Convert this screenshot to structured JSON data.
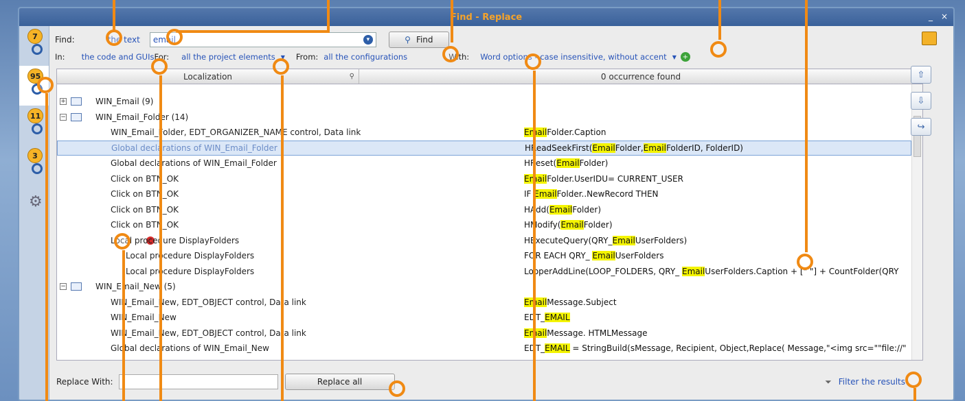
{
  "window": {
    "title": "Find - Replace",
    "minimize": "_",
    "close": "×"
  },
  "sidebar": {
    "tabs": [
      {
        "badge": "7",
        "icon": "search-icon"
      },
      {
        "badge": "95",
        "icon": "search-icon"
      },
      {
        "badge": "11",
        "icon": "search-icon"
      },
      {
        "badge": "3",
        "icon": "search-icon"
      },
      {
        "badge": "",
        "icon": "gear-icon"
      }
    ]
  },
  "toolbar": {
    "find_label": "Find:",
    "find_link": "the text",
    "find_value": "email",
    "find_button": "Find",
    "in_label": "In:",
    "in_value": "the code and GUIs",
    "for_label": "For:",
    "for_value": "all the project elements",
    "from_label": "From:",
    "from_value": "all the configurations",
    "with_label": "With:",
    "with_value": "Word options - case insensitive, without accent"
  },
  "grid": {
    "col1": "Localization",
    "col2": "0 occurrence found",
    "rows": [
      {
        "type": "group",
        "label": "WIN_Email (9)",
        "expand": "+",
        "code": ""
      },
      {
        "type": "group",
        "label": "WIN_Email_Folder (14)",
        "expand": "−",
        "code": ""
      },
      {
        "type": "item",
        "label": "WIN_Email_Folder, EDT_ORGANIZER_NAME control, Data link",
        "code": "EmailFolder.Caption"
      },
      {
        "type": "item",
        "label": "Global declarations of WIN_Email_Folder",
        "code": "HReadSeekFirst(EmailFolder,EmailFolderID, FolderID)",
        "selected": true
      },
      {
        "type": "item",
        "label": "Global declarations of WIN_Email_Folder",
        "code": "HReset(EmailFolder)"
      },
      {
        "type": "item",
        "label": "Click on BTN_OK",
        "code": "EmailFolder.UserIDU= CURRENT_USER"
      },
      {
        "type": "item",
        "label": "Click on BTN_OK",
        "code": "IF EmailFolder..NewRecord THEN"
      },
      {
        "type": "item",
        "label": "Click on BTN_OK",
        "code": "HAdd(EmailFolder)"
      },
      {
        "type": "item",
        "label": "Click on BTN_OK",
        "code": "HModify(EmailFolder)"
      },
      {
        "type": "item",
        "label": "Local procedure DisplayFolders",
        "code": "HExecuteQuery(QRY_EmailUserFolders)",
        "breakpoint": true
      },
      {
        "type": "sub",
        "label": "Local procedure DisplayFolders",
        "code": "FOR EACH QRY_ EmailUserFolders"
      },
      {
        "type": "sub",
        "label": "Local procedure DisplayFolders",
        "code": "LooperAddLine(LOOP_FOLDERS, QRY_ EmailUserFolders.Caption + [\" \"] + CountFolder(QRY"
      },
      {
        "type": "group",
        "label": "WIN_Email_New (5)",
        "expand": "−",
        "code": ""
      },
      {
        "type": "item",
        "label": "WIN_Email_New, EDT_OBJECT control, Data link",
        "code": "EmailMessage.Subject"
      },
      {
        "type": "item",
        "label": "WIN_Email_New",
        "code": "EDT_EMAIL"
      },
      {
        "type": "item",
        "label": "WIN_Email_New, EDT_OBJECT control, Data link",
        "code": "EmailMessage. HTMLMessage"
      },
      {
        "type": "item",
        "label": "Global declarations of WIN_Email_New",
        "code": "EDT_EMAIL = StringBuild(sMessage, Recipient, Object,Replace( Message,\"<img src=\"\"file://\""
      }
    ]
  },
  "bottom": {
    "replace_label": "Replace With:",
    "replace_value": "",
    "replace_all": "Replace all",
    "filter": "Filter the results"
  },
  "colors": {
    "accent": "#f08a14",
    "title": "#f5a32a",
    "link": "#2753b8",
    "highlight": "#f4f400"
  }
}
